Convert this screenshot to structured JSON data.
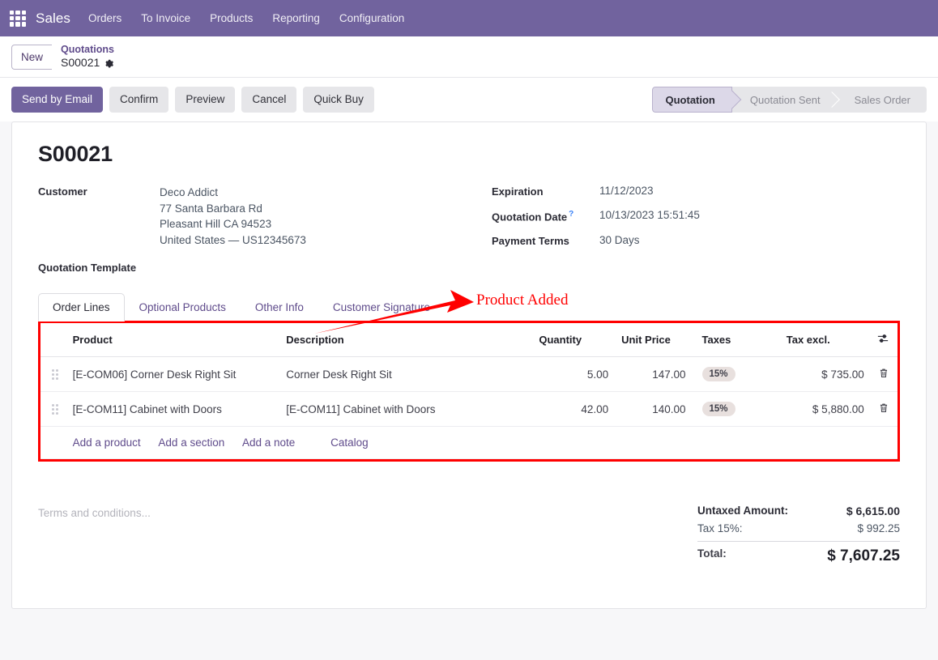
{
  "navbar": {
    "apps_icon": "apps-grid-icon",
    "brand": "Sales",
    "menus": [
      "Orders",
      "To Invoice",
      "Products",
      "Reporting",
      "Configuration"
    ]
  },
  "breadcrumb": {
    "new_label": "New",
    "parent": "Quotations",
    "current": "S00021",
    "settings_icon": "gear-icon"
  },
  "actions": {
    "primary": "Send by Email",
    "secondary": [
      "Confirm",
      "Preview",
      "Cancel",
      "Quick Buy"
    ]
  },
  "statusbar": {
    "steps": [
      "Quotation",
      "Quotation Sent",
      "Sales Order"
    ],
    "active": "Quotation"
  },
  "record": {
    "title": "S00021",
    "customer_label": "Customer",
    "customer_name": "Deco Addict",
    "customer_address": [
      "77 Santa Barbara Rd",
      "Pleasant Hill CA 94523",
      "United States — US12345673"
    ],
    "quotation_template_label": "Quotation Template",
    "quotation_template_value": "",
    "expiration_label": "Expiration",
    "expiration_value": "11/12/2023",
    "quotation_date_label": "Quotation Date",
    "quotation_date_help": "?",
    "quotation_date_value": "10/13/2023 15:51:45",
    "payment_terms_label": "Payment Terms",
    "payment_terms_value": "30 Days"
  },
  "tabs": [
    {
      "label": "Order Lines",
      "active": true
    },
    {
      "label": "Optional Products",
      "active": false
    },
    {
      "label": "Other Info",
      "active": false
    },
    {
      "label": "Customer Signature",
      "active": false
    }
  ],
  "order_lines": {
    "columns": {
      "product": "Product",
      "description": "Description",
      "quantity": "Quantity",
      "unit_price": "Unit Price",
      "taxes": "Taxes",
      "tax_excl": "Tax excl."
    },
    "options_icon": "sliders-icon",
    "rows": [
      {
        "handle_icon": "drag-handle-icon",
        "product": "[E-COM06] Corner Desk Right Sit",
        "description": "Corner Desk Right Sit",
        "quantity": "5.00",
        "unit_price": "147.00",
        "taxes": "15%",
        "tax_excl": "$ 735.00",
        "delete_icon": "trash-icon"
      },
      {
        "handle_icon": "drag-handle-icon",
        "product": "[E-COM11] Cabinet with Doors",
        "description": "[E-COM11] Cabinet with Doors",
        "quantity": "42.00",
        "unit_price": "140.00",
        "taxes": "15%",
        "tax_excl": "$ 5,880.00",
        "delete_icon": "trash-icon"
      }
    ],
    "add_links": [
      "Add a product",
      "Add a section",
      "Add a note"
    ],
    "catalog_link": "Catalog"
  },
  "footer": {
    "terms_placeholder": "Terms and conditions...",
    "untaxed_label": "Untaxed Amount:",
    "untaxed_value": "$ 6,615.00",
    "tax_label": "Tax 15%:",
    "tax_value": "$ 992.25",
    "total_label": "Total:",
    "total_value": "$ 7,607.25"
  },
  "annotation": {
    "text": "Product Added",
    "color": "#ff0000",
    "arrow": "red-arrow",
    "highlight_box": "red-rectangle-around-order-lines"
  },
  "colors": {
    "navbar": "#71639e",
    "primary": "#71639e",
    "link": "#5f4b8b",
    "annotation": "#ff0000",
    "tax_pill": "#e8e0de"
  }
}
